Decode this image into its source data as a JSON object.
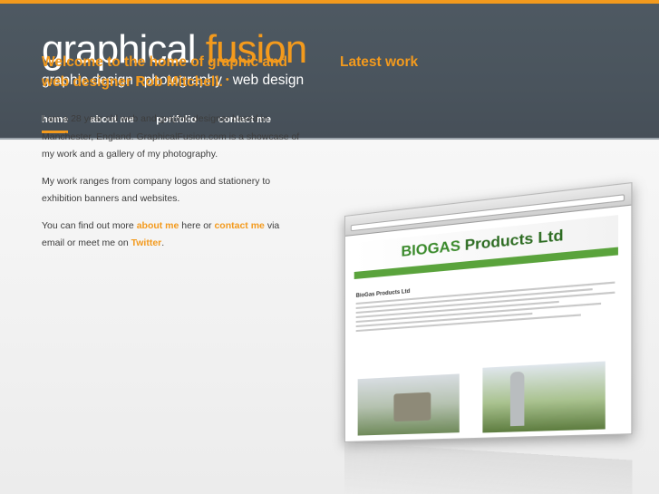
{
  "header": {
    "logo_word1": "graphical",
    "logo_word2": "fusion",
    "tagline_1": "graphic design",
    "tagline_2": "photography",
    "tagline_3": "web design",
    "tagline_separator": "•"
  },
  "nav": {
    "items": [
      {
        "label": "home",
        "active": true
      },
      {
        "label": "about me",
        "active": false
      },
      {
        "label": "portfolio",
        "active": false
      },
      {
        "label": "contact me",
        "active": false
      }
    ]
  },
  "welcome": {
    "heading": "Welcome to the home of graphic and web designer Rob Mitchell.",
    "para1": "I am a 28 year old web and graphic designer based in Manchester, England. GraphicalFusion.com is a showcase of my work and a gallery of my photography.",
    "para2": "My work ranges from company logos and stationery to exhibition banners and websites.",
    "para3_pre": "You can find out more ",
    "para3_link1": "about me",
    "para3_mid": " here or ",
    "para3_link2": "contact me",
    "para3_post": " via email or meet me on ",
    "para3_link3": "Twitter",
    "para3_end": "."
  },
  "latest": {
    "heading": "Latest work",
    "screenshot_brand_1": "BIOGAS",
    "screenshot_brand_2": "Products Ltd",
    "screenshot_heading": "BioGas Products Ltd"
  },
  "colors": {
    "accent": "#f39a1d",
    "header_bg": "#4b555e",
    "body_text": "#3d3d3d"
  }
}
